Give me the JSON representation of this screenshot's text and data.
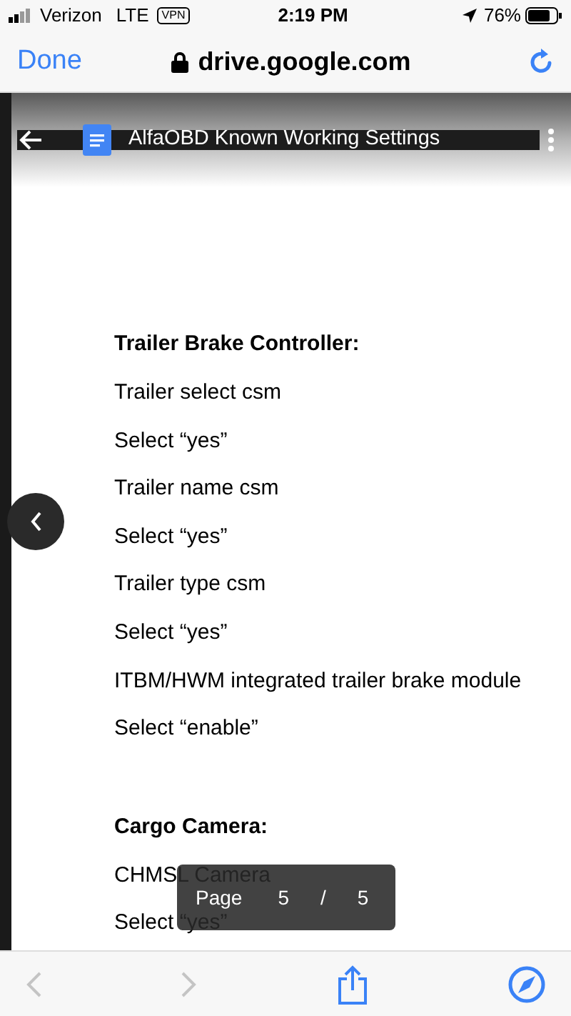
{
  "status_bar": {
    "carrier": "Verizon",
    "network": "LTE",
    "vpn": "VPN",
    "time": "2:19 PM",
    "battery": "76%"
  },
  "browser_bar": {
    "done": "Done",
    "url": "drive.google.com"
  },
  "doc_header": {
    "title": "AlfaOBD Known Working Settings"
  },
  "sections": [
    {
      "heading": "Trailer Brake Controller:",
      "lines": [
        "Trailer select csm",
        "Select “yes”",
        "Trailer name csm",
        "Select “yes”",
        "Trailer type csm",
        "Select “yes”",
        "ITBM/HWM integrated trailer brake module",
        "Select “enable”"
      ]
    },
    {
      "heading": "Cargo Camera:",
      "lines": [
        "CHMSL Camera",
        "Select “yes”"
      ]
    }
  ],
  "page_indicator": {
    "label": "Page",
    "current": "5",
    "separator": "/",
    "total": "5"
  },
  "toolbar": {
    "back_disabled": true,
    "forward_disabled": true
  }
}
